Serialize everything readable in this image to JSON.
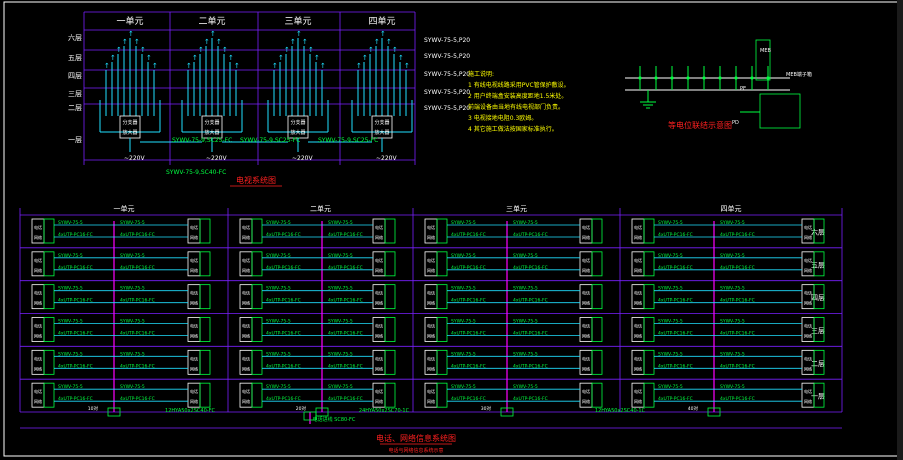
{
  "colors": {
    "bg": "#000000",
    "frame": "#ffffff",
    "grid": "#7a20ff",
    "wire": "#20e0ff",
    "label": "#00ff40",
    "text_yellow": "#ffff00",
    "text_white": "#ffffff",
    "riser": "#ff00ff",
    "title_red": "#ff2020"
  },
  "tv": {
    "units": [
      "一单元",
      "二单元",
      "三单元",
      "四单元"
    ],
    "floors": [
      "六层",
      "五层",
      "四层",
      "三层",
      "二层",
      "一层"
    ],
    "cables": [
      "SYWV-75-5,P20",
      "SYWV-75-5,P20",
      "SYWV-75-5,P20",
      "SYWV-75-5,P20",
      "SYWV-75-5,P20"
    ],
    "box_label": "分支器",
    "amp_label": "放大器",
    "mains": [
      "~220V",
      "~220V",
      "~220V",
      "~220V"
    ],
    "feeders": [
      "SYWV-75-9,SC25-FC",
      "SYWV-75-9,SC25-FC",
      "SYWV-75-9,SC25-FC"
    ],
    "main_feeder": "SYWV-75-9,SC40-FC",
    "title": "电视系统图",
    "notes": [
      "施工说明:",
      "1 有线电视线路采用PVC管保护敷设。",
      "2 用户终端盒安装高度距地1.5米处。",
      "  前端设备由当地有线电视部门负责。",
      "3 电视接地电阻0.3欧姆。",
      "4 其它施工做法按国家标准执行。"
    ]
  },
  "ground": {
    "title": "等电位联结示意图",
    "labels": [
      "MEB",
      "MEB端子箱",
      "PE",
      "PD"
    ]
  },
  "phone": {
    "title": "电话、网络信息系统图",
    "subtitle": "电话与网络信息系统示意",
    "units": [
      "一单元",
      "二单元",
      "三单元",
      "四单元"
    ],
    "floors": [
      "六层",
      "五层",
      "四层",
      "三层",
      "二层",
      "一层"
    ],
    "jack_a": "电话",
    "jack_b": "网络",
    "cable_top": "SYWV-75-5",
    "cable_bot": "4xUTP-PC16-FC",
    "trunk_labels": [
      "12HYA50x2SC40-FC",
      "24HYA50x2SC70-1C",
      "12HYA50x2SC40-1C"
    ],
    "center_label": "电话进线 SC80-FC",
    "pair_labels": [
      "10对",
      "20对",
      "30对",
      "40对"
    ]
  }
}
